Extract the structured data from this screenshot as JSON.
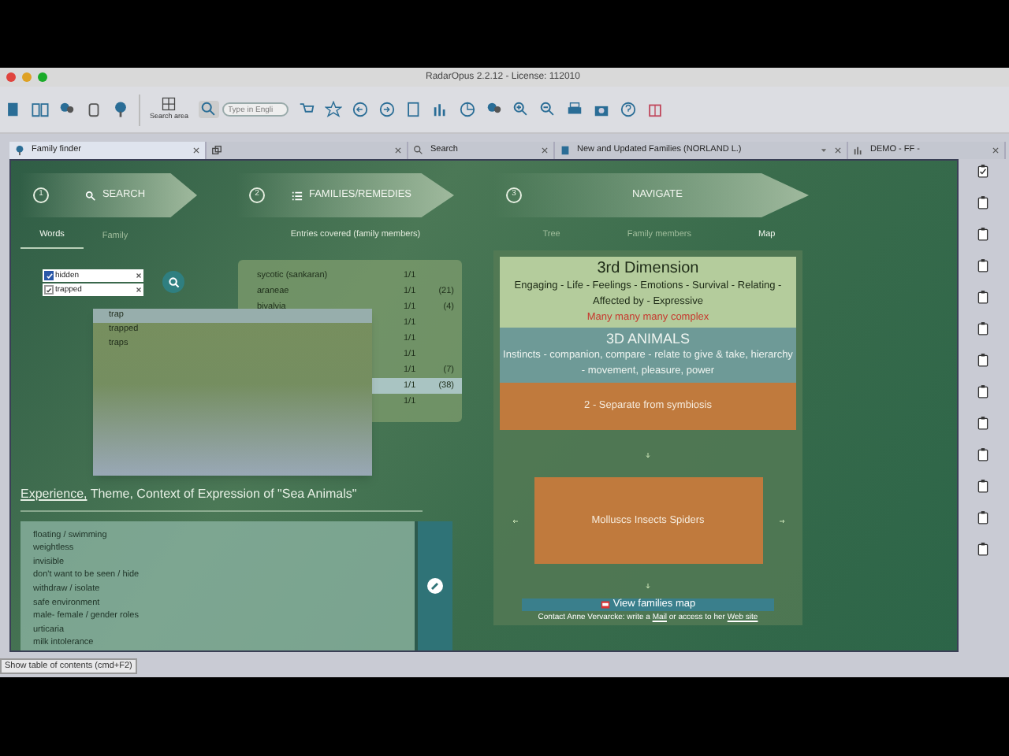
{
  "window": {
    "title": "RadarOpus 2.2.12 - License: 112010"
  },
  "toolbar": {
    "search_area_label": "Search area",
    "search_placeholder": "Type in Engli"
  },
  "tabs": [
    {
      "kind": "finder",
      "label": "Family finder",
      "selected": true
    },
    {
      "kind": "icon",
      "selected": false
    },
    {
      "kind": "search",
      "label": "Search",
      "selected": false
    },
    {
      "kind": "book",
      "label": "New and Updated Families (NORLAND L.)",
      "selected": false
    },
    {
      "kind": "chart",
      "label": "DEMO - FF -",
      "selected": false
    }
  ],
  "steps": [
    {
      "number": "1",
      "label": "SEARCH",
      "kind": "search"
    },
    {
      "number": "2",
      "label": "FAMILIES/REMEDIES",
      "kind": "list"
    },
    {
      "number": "3",
      "label": "NAVIGATE",
      "kind": "navigate"
    }
  ],
  "search_tabs": [
    {
      "label": "Words",
      "selected": true
    },
    {
      "label": "Family",
      "selected": false
    }
  ],
  "words": [
    {
      "text": "hidden",
      "checked": true
    },
    {
      "text": "trapped",
      "checked": true
    }
  ],
  "suggestions": [
    {
      "label": "trap",
      "selected": true
    },
    {
      "label": "trapped",
      "selected": false
    },
    {
      "label": "traps",
      "selected": false
    }
  ],
  "families": {
    "heading": "Entries covered (family members)",
    "rows": [
      {
        "name": "sycotic (sankaran)",
        "coverage": "1/1",
        "selected": false
      },
      {
        "name": "araneae",
        "coverage": "1/1",
        "count": "(21)",
        "selected": false
      },
      {
        "name": "bivalvia",
        "coverage": "1/1",
        "count": "(4)",
        "selected": false
      },
      {
        "coverage": "1/1",
        "selected": false
      },
      {
        "coverage": "1/1",
        "selected": false
      },
      {
        "coverage": "1/1",
        "selected": false
      },
      {
        "coverage": "1/1",
        "count": "(7)",
        "selected": false
      },
      {
        "coverage": "1/1",
        "count": "(38)",
        "selected": true
      },
      {
        "coverage": "1/1",
        "selected": false
      }
    ]
  },
  "navigate_tabs": [
    {
      "label": "Tree",
      "selected": false
    },
    {
      "label": "Family members",
      "selected": false
    },
    {
      "label": "Map",
      "selected": true
    }
  ],
  "map": {
    "boxes": [
      {
        "kind": "dimension",
        "title": "3rd Dimension",
        "text": "Engaging - Life - Feelings - Emotions - Survival - Relating - Affected by - Expressive",
        "note": "Many many many complex"
      },
      {
        "kind": "animals",
        "title": "3D ANIMALS",
        "text": "Instincts - companion, compare - relate to give & take, hierarchy - movement, pleasure, power"
      },
      {
        "kind": "stage",
        "text": "2 - Separate from symbiosis"
      }
    ],
    "center": "Molluscs Insects Spiders",
    "button": "View families map",
    "contact": [
      {
        "kind": "text",
        "text": "Contact Anne Vervarcke: write a "
      },
      {
        "kind": "link",
        "text": "Mail"
      },
      {
        "kind": "text",
        "text": " or access to her "
      },
      {
        "kind": "link",
        "text": "Web site"
      }
    ]
  },
  "experience": {
    "heading_link": "Experience,",
    "heading_text": "Theme, Context of Expression of \"Sea Animals\"",
    "items": [
      "floating / swimming",
      "weightless",
      "invisible",
      "don't want to be seen / hide",
      "withdraw / isolate",
      "safe environment",
      "male- female / gender roles",
      "urticaria",
      "milk intolerance"
    ]
  },
  "status_bar": "Show table of contents (cmd+F2)"
}
